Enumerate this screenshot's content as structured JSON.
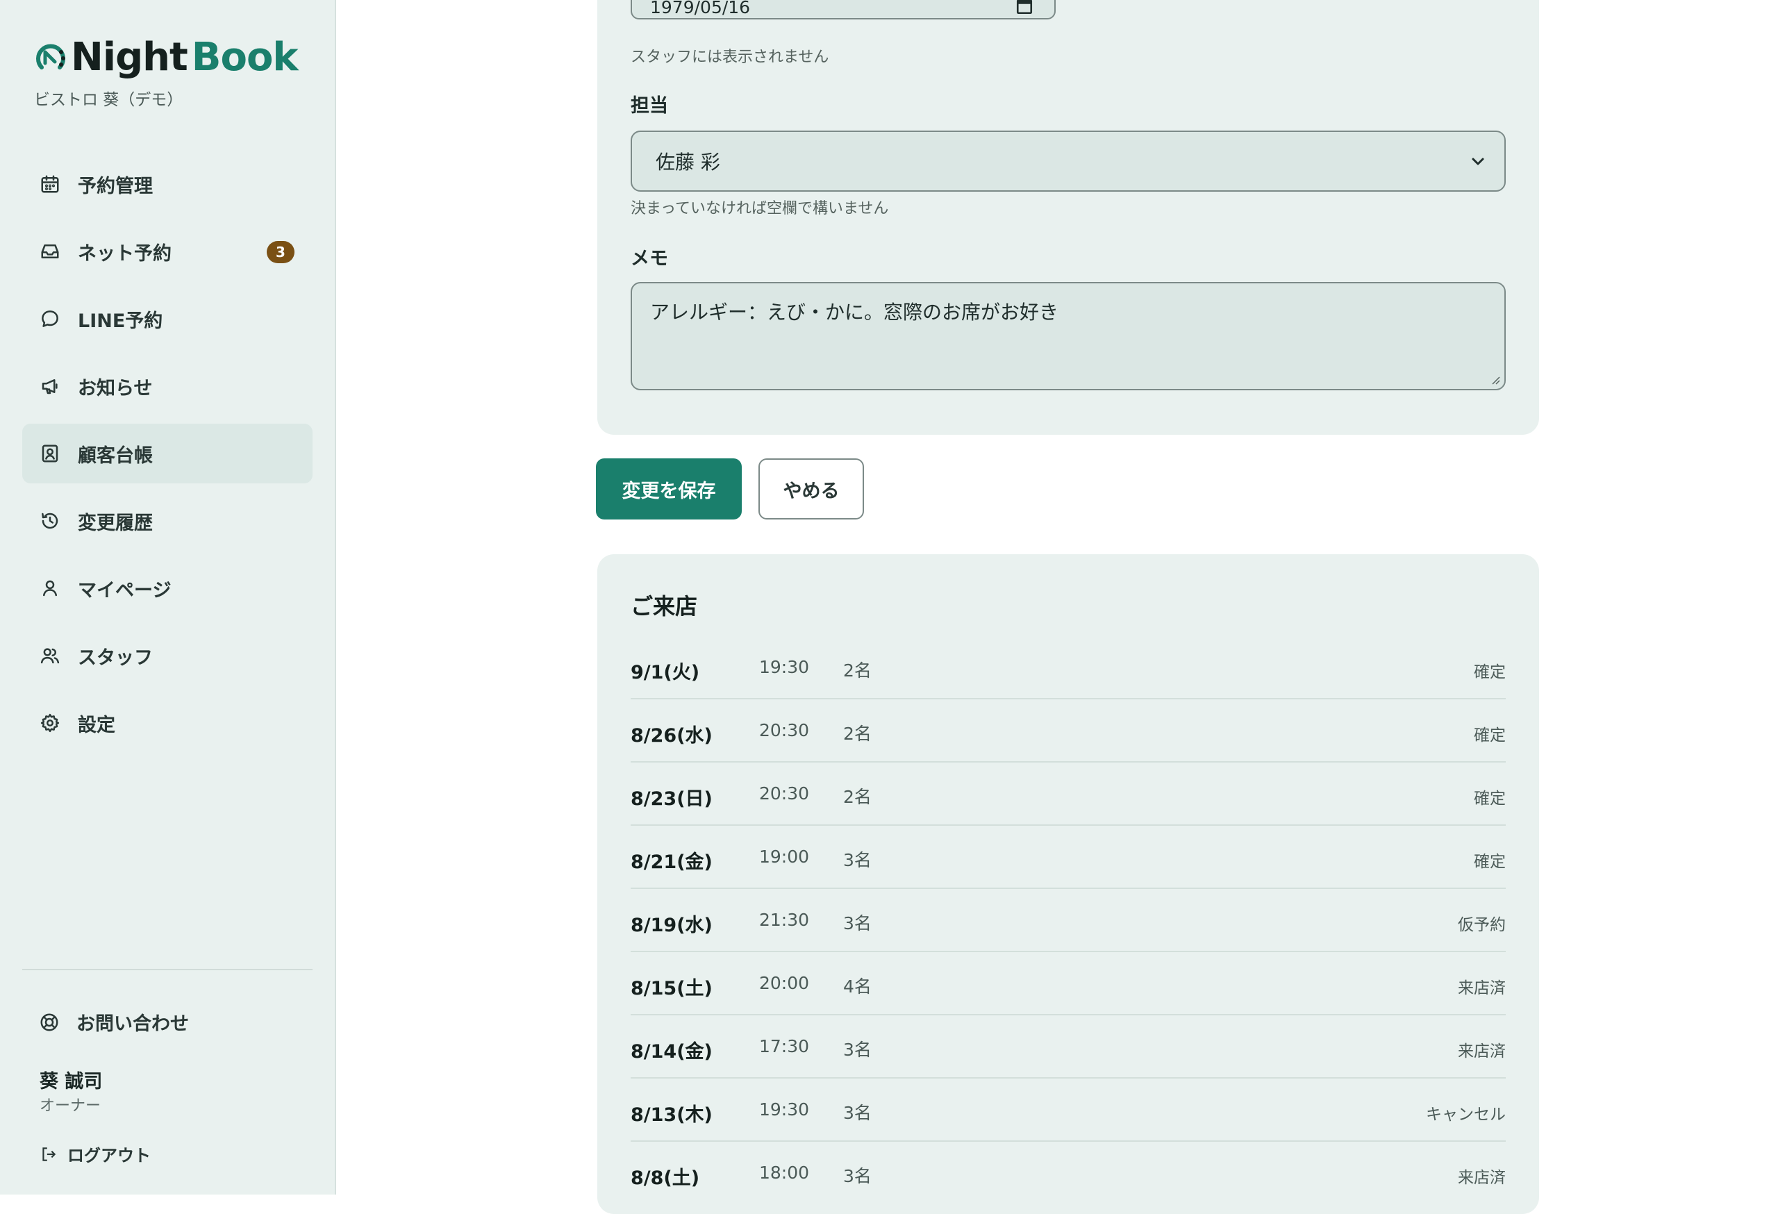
{
  "brand": {
    "name_part1": "Night",
    "name_part2": "Book",
    "org": "ビストロ 葵（デモ）"
  },
  "nav": {
    "items": [
      {
        "label": "予約管理",
        "icon": "calendar-icon"
      },
      {
        "label": "ネット予約",
        "icon": "inbox-icon",
        "badge": "3"
      },
      {
        "label": "LINE予約",
        "icon": "chat-bubble-icon"
      },
      {
        "label": "お知らせ",
        "icon": "megaphone-icon"
      },
      {
        "label": "顧客台帳",
        "icon": "contact-card-icon",
        "active": true
      },
      {
        "label": "変更履歴",
        "icon": "history-icon"
      },
      {
        "label": "マイページ",
        "icon": "user-icon"
      },
      {
        "label": "スタッフ",
        "icon": "users-icon"
      },
      {
        "label": "設定",
        "icon": "gear-icon"
      }
    ]
  },
  "footer": {
    "contact_label": "お問い合わせ",
    "user_name": "葵 誠司",
    "user_role": "オーナー",
    "logout_label": "ログアウト"
  },
  "form": {
    "birthday_value": "1979/05/16",
    "birthday_hint": "スタッフには表示されません",
    "staff_label": "担当",
    "staff_value": "佐藤 彩",
    "staff_hint": "決まっていなければ空欄で構いません",
    "memo_label": "メモ",
    "memo_value": "アレルギー：えび・かに。窓際のお席がお好き"
  },
  "actions": {
    "save_label": "変更を保存",
    "cancel_label": "やめる"
  },
  "visits": {
    "title": "ご来店",
    "rows": [
      {
        "date": "9/1(火)",
        "time": "19:30",
        "party": "2名",
        "status": "確定"
      },
      {
        "date": "8/26(水)",
        "time": "20:30",
        "party": "2名",
        "status": "確定"
      },
      {
        "date": "8/23(日)",
        "time": "20:30",
        "party": "2名",
        "status": "確定"
      },
      {
        "date": "8/21(金)",
        "time": "19:00",
        "party": "3名",
        "status": "確定"
      },
      {
        "date": "8/19(水)",
        "time": "21:30",
        "party": "3名",
        "status": "仮予約"
      },
      {
        "date": "8/15(土)",
        "time": "20:00",
        "party": "4名",
        "status": "来店済"
      },
      {
        "date": "8/14(金)",
        "time": "17:30",
        "party": "3名",
        "status": "来店済"
      },
      {
        "date": "8/13(木)",
        "time": "19:30",
        "party": "3名",
        "status": "キャンセル"
      },
      {
        "date": "8/8(土)",
        "time": "18:00",
        "party": "3名",
        "status": "来店済"
      }
    ]
  },
  "colors": {
    "accent": "#1a7f6c",
    "badge": "#7a5014",
    "panel": "#e9f1ef"
  }
}
